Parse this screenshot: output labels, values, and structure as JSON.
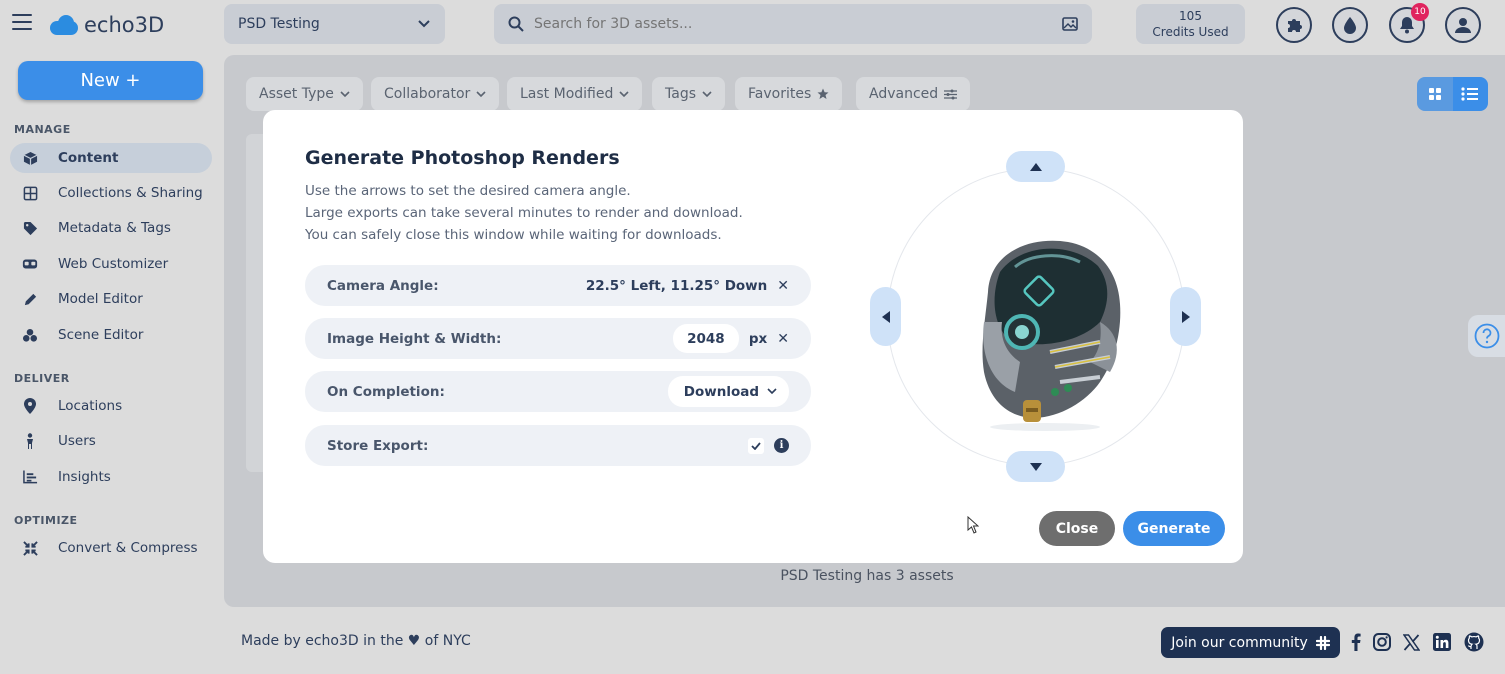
{
  "header": {
    "logo_text": "echo3D",
    "project": "PSD Testing",
    "search_placeholder": "Search for 3D assets...",
    "credits_count": "105",
    "credits_label": "Credits Used",
    "notifications_count": "10"
  },
  "sidebar": {
    "new_button": "New +",
    "sections": {
      "manage": "MANAGE",
      "deliver": "DELIVER",
      "optimize": "OPTIMIZE"
    },
    "manage_items": [
      {
        "label": "Content",
        "icon": "cube-icon"
      },
      {
        "label": "Collections & Sharing",
        "icon": "grid-icon"
      },
      {
        "label": "Metadata & Tags",
        "icon": "tag-icon"
      },
      {
        "label": "Web Customizer",
        "icon": "vr-headset-icon"
      },
      {
        "label": "Model Editor",
        "icon": "pencil-icon"
      },
      {
        "label": "Scene Editor",
        "icon": "cubes-icon"
      }
    ],
    "deliver_items": [
      {
        "label": "Locations",
        "icon": "map-pin-icon"
      },
      {
        "label": "Users",
        "icon": "person-icon"
      },
      {
        "label": "Insights",
        "icon": "bar-chart-icon"
      }
    ],
    "optimize_items": [
      {
        "label": "Convert & Compress",
        "icon": "compress-icon"
      }
    ]
  },
  "filters": {
    "asset_type": "Asset Type",
    "collaborator": "Collaborator",
    "last_modified": "Last Modified",
    "tags": "Tags",
    "favorites": "Favorites",
    "advanced": "Advanced"
  },
  "main": {
    "asset_count_text": "PSD Testing has 3 assets"
  },
  "footer": {
    "made_by_prefix": "Made by echo3D in the",
    "heart": "♥",
    "made_by_suffix": "of NYC",
    "community_button": "Join our community"
  },
  "modal": {
    "title": "Generate Photoshop Renders",
    "desc_line1": "Use the arrows to set the desired camera angle.",
    "desc_line2": "Large exports can take several minutes to render and download.",
    "desc_line3": "You can safely close this window while waiting for downloads.",
    "camera_angle_label": "Camera Angle:",
    "camera_angle_value": "22.5° Left,  11.25° Down",
    "image_size_label": "Image Height & Width:",
    "image_size_value": "2048",
    "image_size_unit": "px",
    "on_completion_label": "On Completion:",
    "on_completion_value": "Download",
    "store_export_label": "Store Export:",
    "store_export_checked": true,
    "close_button": "Close",
    "generate_button": "Generate"
  },
  "colors": {
    "accent": "#3b8ee8",
    "navy": "#1e3152",
    "text": "#2d3e5c",
    "badge": "#e0245e"
  }
}
